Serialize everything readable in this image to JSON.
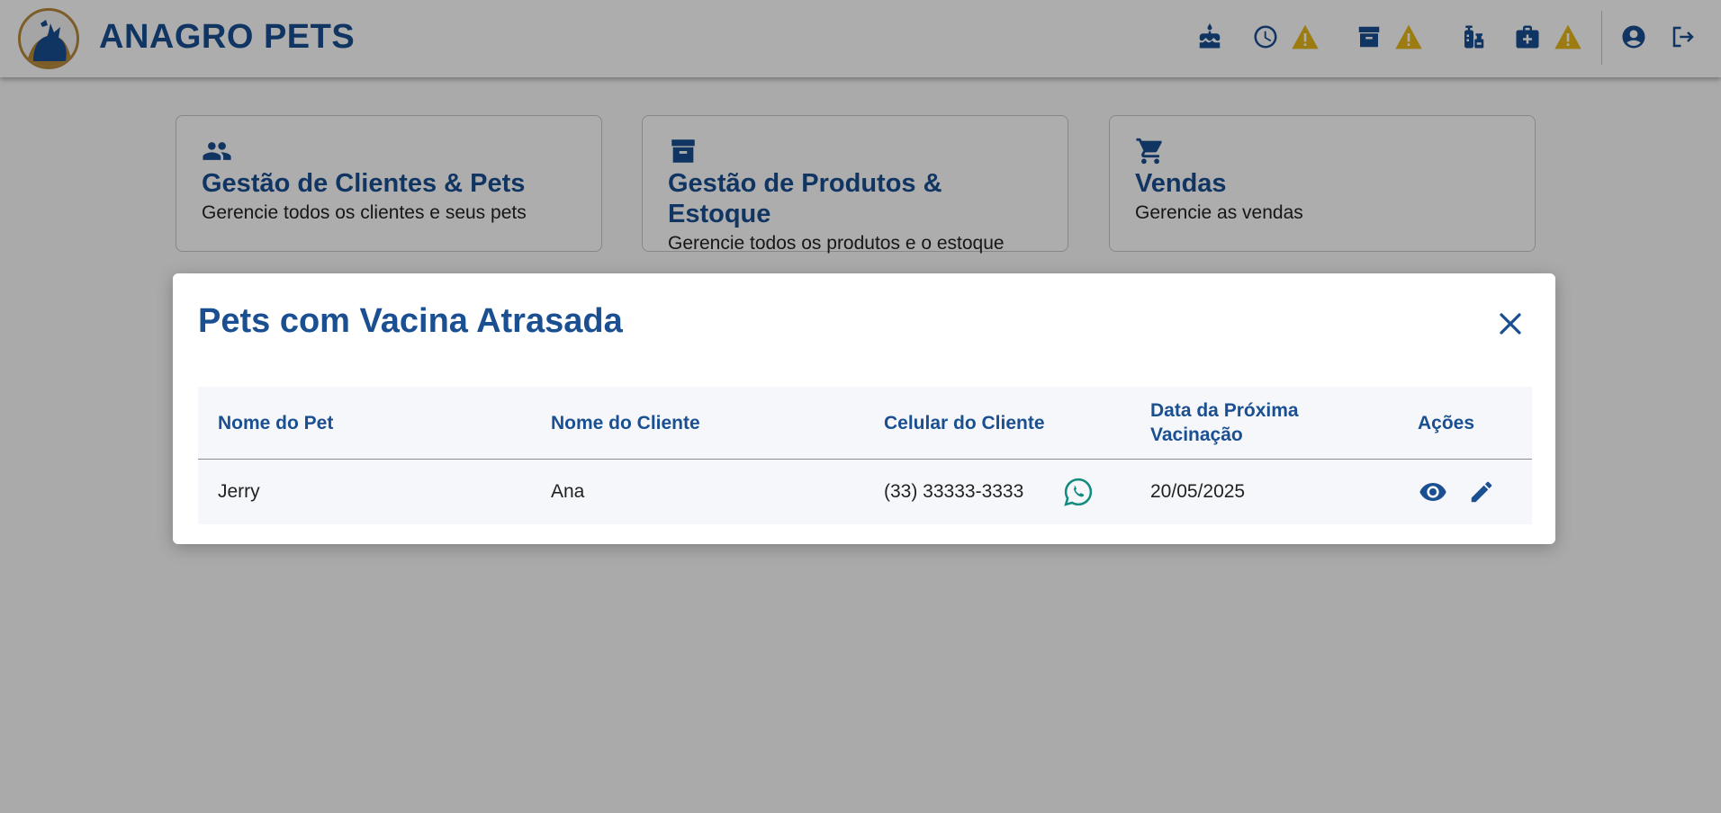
{
  "app": {
    "brand": "ANAGRO PETS"
  },
  "header": {
    "icons": [
      "cake-icon",
      "clock-icon",
      "warning-icon",
      "archive-icon",
      "warning-icon",
      "vaccine-icon",
      "medkit-icon",
      "warning-icon",
      "account-icon",
      "logout-icon"
    ],
    "warning_color": "#e6b619"
  },
  "cards": [
    {
      "title": "Gestão de Clientes & Pets",
      "subtitle": "Gerencie todos os clientes e seus pets",
      "icon": "people-icon"
    },
    {
      "title": "Gestão de Produtos & Estoque",
      "subtitle": "Gerencie todos os produtos e o estoque",
      "icon": "archive-icon"
    },
    {
      "title": "Vendas",
      "subtitle": "Gerencie as vendas",
      "icon": "cart-icon"
    }
  ],
  "modal": {
    "title": "Pets com Vacina Atrasada",
    "close_icon": "close-icon",
    "columns": [
      "Nome do Pet",
      "Nome do Cliente",
      "Celular do Cliente",
      "Data da Próxima Vacinação",
      "Ações"
    ],
    "rows": [
      {
        "pet": "Jerry",
        "client": "Ana",
        "phone": "(33) 33333-3333",
        "next_vaccination": "20/05/2025"
      }
    ]
  },
  "colors": {
    "primary": "#1a4f91",
    "whatsapp": "#128c7e",
    "overlay": "rgba(0,0,0,0.32)"
  }
}
